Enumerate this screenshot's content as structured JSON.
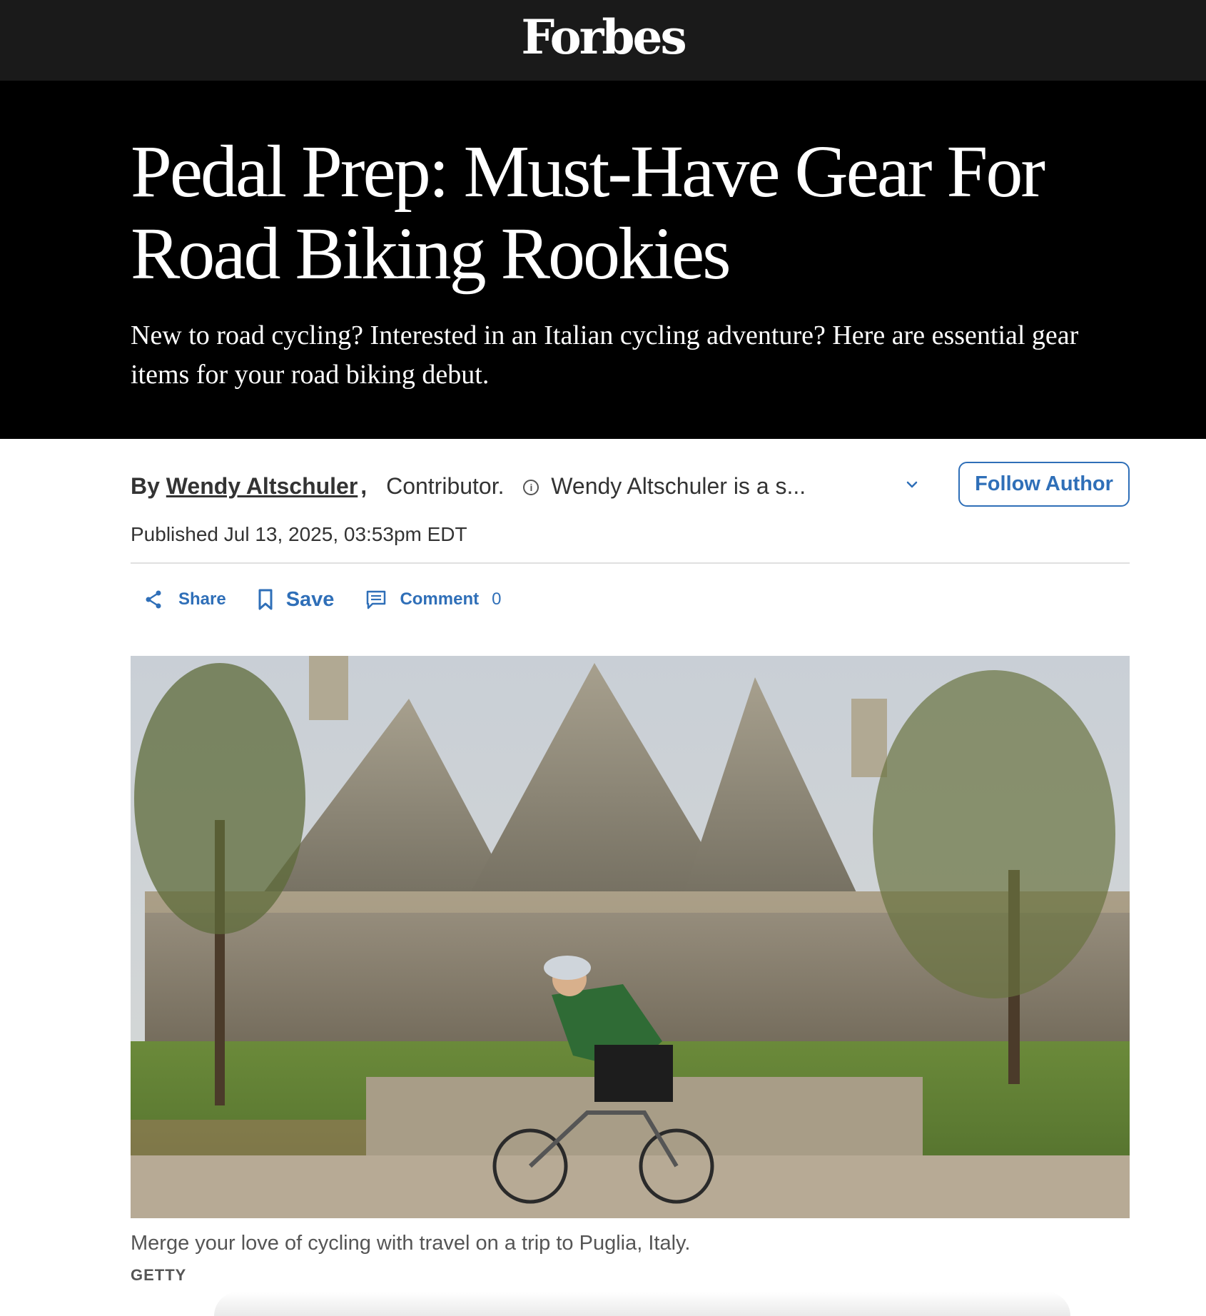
{
  "site": {
    "logo": "Forbes"
  },
  "article": {
    "headline": "Pedal Prep: Must-Have Gear For Road Biking Rookies",
    "dek": "New to road cycling? Interested in an Italian cycling adventure? Here are essential gear items for your road biking debut.",
    "byline": {
      "by": "By",
      "author": "Wendy Altschuler",
      "comma": ",",
      "role": "Contributor.",
      "bio_excerpt": "Wendy Altschuler is a s...",
      "follow_label": "Follow Author"
    },
    "published": "Published Jul 13, 2025, 03:53pm EDT"
  },
  "actions": {
    "share_label": "Share",
    "save_label": "Save",
    "comment_label": "Comment",
    "comment_count": "0"
  },
  "media": {
    "caption": "Merge your love of cycling with travel on a trip to Puglia, Italy.",
    "credit": "GETTY"
  },
  "colors": {
    "link_blue": "#2f6fb8",
    "topbar": "#1a1a1a",
    "hero_bg": "#000000"
  },
  "icons": [
    "info-icon",
    "chevron-down-icon",
    "share-icon",
    "bookmark-icon",
    "comment-icon"
  ]
}
